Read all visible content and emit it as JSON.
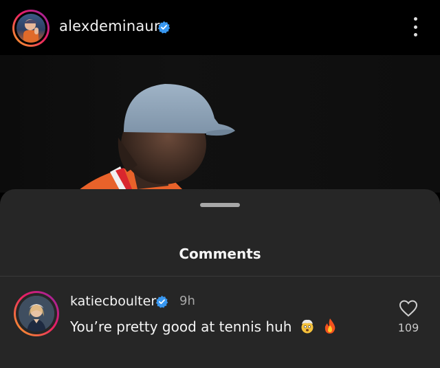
{
  "post": {
    "username": "alexdeminaur",
    "verified": true
  },
  "comments_sheet": {
    "title": "Comments"
  },
  "comment": {
    "username": "katiecboulter",
    "verified": true,
    "time": "9h",
    "text": "You’re pretty good at tennis huh",
    "emojis": [
      "exploding-head-emoji",
      "fire-emoji"
    ],
    "likes": "109"
  },
  "colors": {
    "background": "#000000",
    "sheet": "#262626",
    "verified_blue": "#3897f0",
    "story_ring_start": "#f9a825",
    "story_ring_end": "#8e24aa"
  }
}
